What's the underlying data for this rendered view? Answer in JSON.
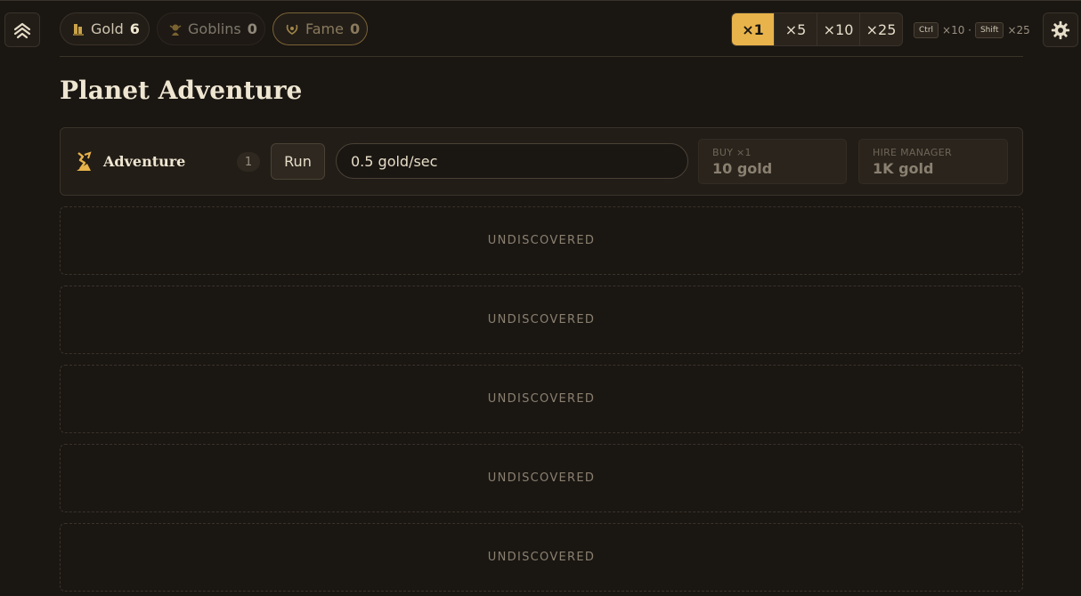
{
  "resources": {
    "gold": {
      "label": "Gold",
      "value": "6"
    },
    "goblins": {
      "label": "Goblins",
      "value": "0"
    },
    "fame": {
      "label": "Fame",
      "value": "0"
    }
  },
  "multipliers": [
    "×1",
    "×5",
    "×10",
    "×25"
  ],
  "active_multiplier": "×1",
  "hotkeys": {
    "ctrl_key": "Ctrl",
    "ctrl_value": "×10 ·",
    "shift_key": "Shift",
    "shift_value": "×25"
  },
  "page_title": "Planet Adventure",
  "business": {
    "name": "Adventure",
    "count": "1",
    "run_label": "Run",
    "rate": "0.5 gold/sec",
    "progress": 0,
    "buy_caption": "BUY ×1",
    "buy_cost": "10 gold",
    "manager_caption": "HIRE MANAGER",
    "manager_cost": "1K gold"
  },
  "undiscovered": [
    "UNDISCOVERED",
    "UNDISCOVERED",
    "UNDISCOVERED",
    "UNDISCOVERED",
    "UNDISCOVERED"
  ],
  "icons": {
    "menu": "chevrons-up-icon",
    "gold": "gold-coins-icon",
    "goblins": "goblin-icon",
    "fame": "laurel-icon",
    "settings": "gear-icon",
    "business": "adventure-icon"
  },
  "colors": {
    "accent": "#e8b34a",
    "background": "#1a1612",
    "panel": "#221d17"
  }
}
